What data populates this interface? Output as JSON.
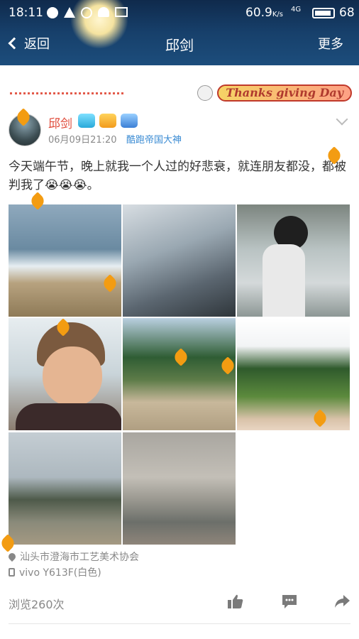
{
  "status": {
    "time": "18:11",
    "battery_pct": "60.9",
    "speed_unit": "K/s",
    "net": "4G",
    "battery": "68"
  },
  "nav": {
    "back_label": "返回",
    "title": "邱剑",
    "more_label": "更多"
  },
  "banner": {
    "text": "Thanks giving Day"
  },
  "post": {
    "author": "邱剑",
    "time": "06月09日21:20",
    "level": "酷跑帝国大神",
    "text": "今天端午节，晚上就我一个人过的好悲衰，就连朋友都没，都被判我了😭😭😭。",
    "photos": [
      {
        "name": "beach-crowd"
      },
      {
        "name": "rocks-waves"
      },
      {
        "name": "man-in-sea"
      },
      {
        "name": "selfie"
      },
      {
        "name": "coast-path"
      },
      {
        "name": "hill-field"
      },
      {
        "name": "shore-people"
      },
      {
        "name": "sea-horizon"
      }
    ],
    "location": "汕头市澄海市工艺美术协会",
    "device": "vivo  Y613F(白色)",
    "views": "浏览260次"
  },
  "colors": {
    "accent": "#e04b3a",
    "header": "#17406b",
    "link": "#3a8bd3",
    "muted": "#888888"
  }
}
